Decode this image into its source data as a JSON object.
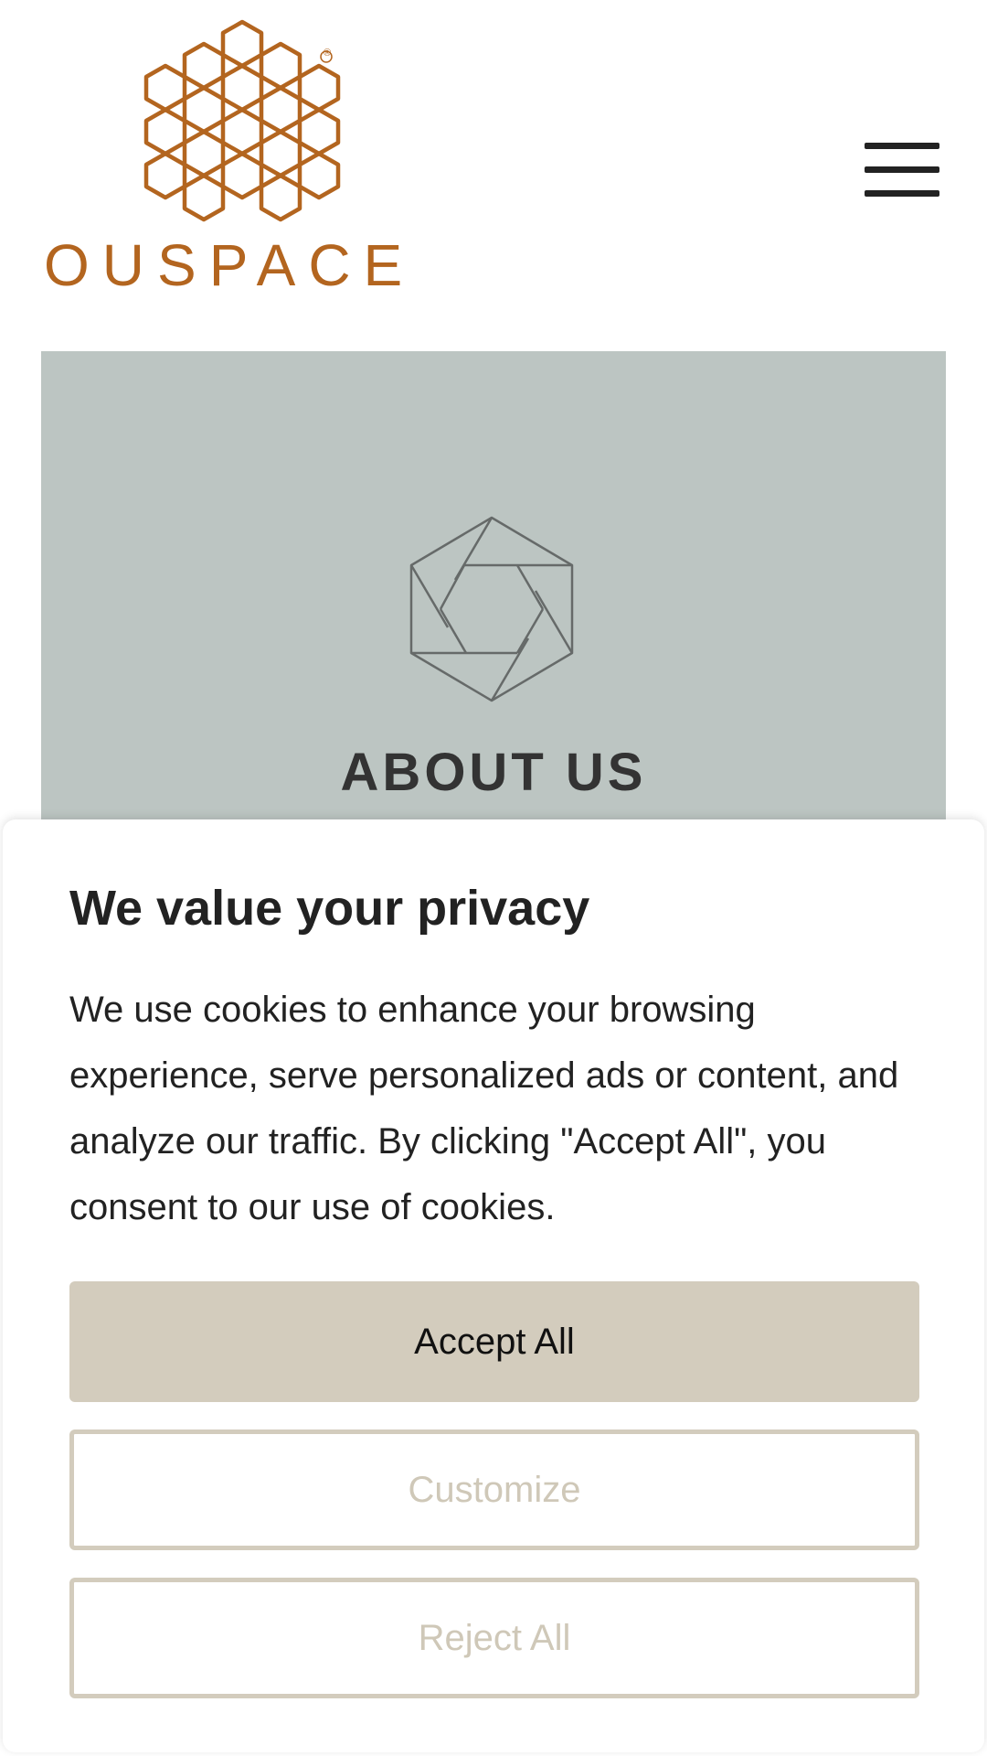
{
  "header": {
    "logo_text": "OUSPACE",
    "logo_registered_mark": "®",
    "menu_icon": "hamburger-menu-icon"
  },
  "hero": {
    "icon": "hexagon-aperture-icon",
    "title": "ABOUT US",
    "background_color": "#bcc5c2"
  },
  "consent": {
    "title": "We value your privacy",
    "body": "We use cookies to enhance your browsing experience, serve personalized ads or content, and analyze our traffic. By clicking \"Accept All\", you consent to our use of cookies.",
    "accept_label": "Accept All",
    "customize_label": "Customize",
    "reject_label": "Reject All"
  },
  "colors": {
    "brand": "#b3651f",
    "button_accent": "#d3ccbd",
    "text_dark": "#222222"
  }
}
